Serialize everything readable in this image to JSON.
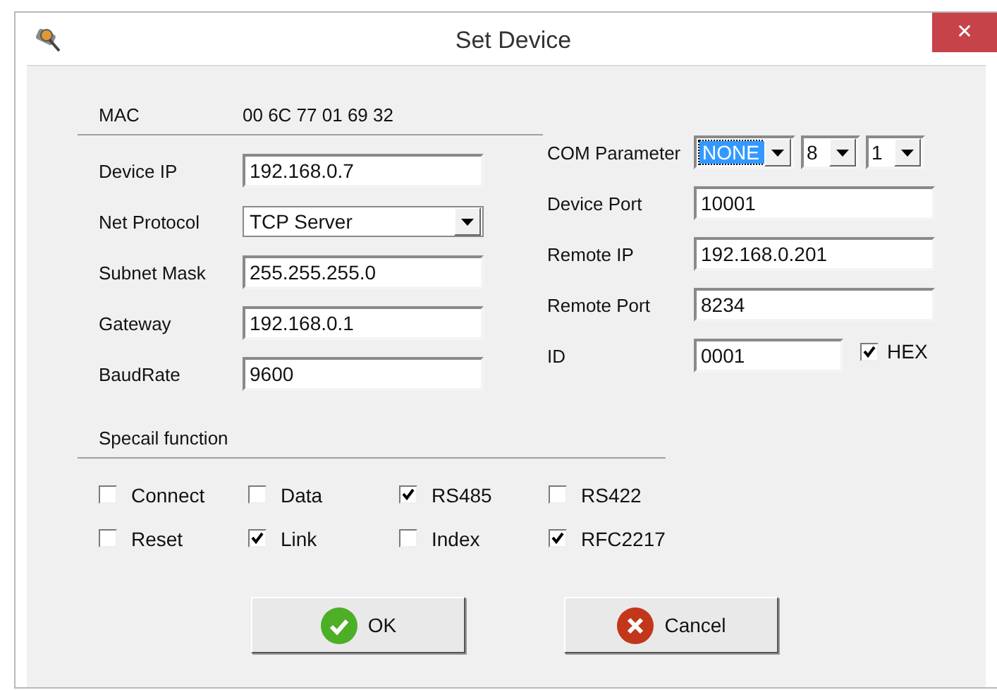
{
  "window": {
    "title": "Set Device",
    "close": "✕"
  },
  "mac": {
    "label": "MAC",
    "value": "00 6C 77 01 69 32"
  },
  "left_fields": [
    {
      "kind": "text",
      "label": "Device IP",
      "value": "192.168.0.7"
    },
    {
      "kind": "select",
      "label": "Net Protocol",
      "value": "TCP Server"
    },
    {
      "kind": "text",
      "label": "Subnet Mask",
      "value": "255.255.255.0"
    },
    {
      "kind": "text",
      "label": "Gateway",
      "value": "192.168.0.1"
    },
    {
      "kind": "text",
      "label": "BaudRate",
      "value": "9600"
    }
  ],
  "com_parameter": {
    "label": "COM Parameter",
    "selects": [
      {
        "value": "NONE",
        "focused": true
      },
      {
        "value": "8",
        "focused": false
      },
      {
        "value": "1",
        "focused": false
      }
    ]
  },
  "right_fields": [
    {
      "label": "Device Port",
      "value": "10001"
    },
    {
      "label": "Remote IP",
      "value": "192.168.0.201"
    },
    {
      "label": "Remote Port",
      "value": "8234"
    }
  ],
  "id_field": {
    "label": "ID",
    "value": "0001",
    "hex": {
      "label": "HEX",
      "checked": true
    }
  },
  "special": {
    "title": "Specail function",
    "options": [
      {
        "label": "Connect",
        "checked": false
      },
      {
        "label": "Data",
        "checked": false
      },
      {
        "label": "RS485",
        "checked": true
      },
      {
        "label": "RS422",
        "checked": false
      },
      {
        "label": "Reset",
        "checked": false
      },
      {
        "label": "Link",
        "checked": true
      },
      {
        "label": "Index",
        "checked": false
      },
      {
        "label": "RFC2217",
        "checked": true
      }
    ]
  },
  "buttons": [
    {
      "kind": "ok",
      "label": "OK"
    },
    {
      "kind": "cancel",
      "label": "Cancel"
    }
  ]
}
